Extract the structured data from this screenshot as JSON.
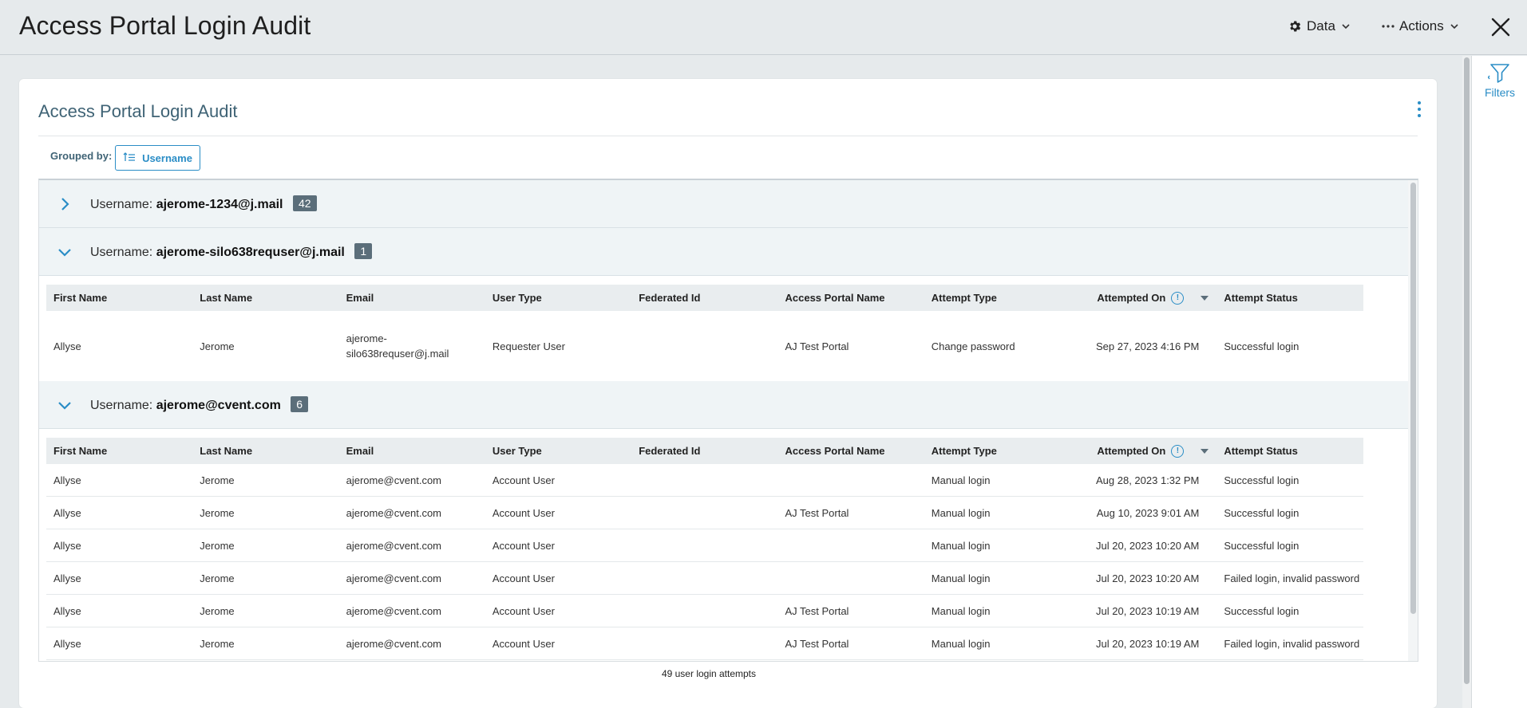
{
  "header": {
    "title": "Access Portal Login Audit",
    "data_label": "Data",
    "actions_label": "Actions"
  },
  "rail": {
    "filters_label": "Filters"
  },
  "card": {
    "title": "Access Portal Login Audit",
    "grouped_by_label": "Grouped by:",
    "group_chip_label": "Username"
  },
  "columns": [
    "First Name",
    "Last Name",
    "Email",
    "User Type",
    "Federated Id",
    "Access Portal Name",
    "Attempt Type",
    "Attempted On",
    "Attempt Status"
  ],
  "groups": [
    {
      "prefix": "Username:",
      "username": "ajerome-1234@j.mail",
      "count": "42",
      "expanded": false
    },
    {
      "prefix": "Username:",
      "username": "ajerome-silo638requser@j.mail",
      "count": "1",
      "expanded": true,
      "rows": [
        [
          "Allyse",
          "Jerome",
          "ajerome-silo638requser@j.mail",
          "Requester User",
          "",
          "AJ Test Portal",
          "Change password",
          "Sep 27, 2023 4:16 PM",
          "Successful login"
        ]
      ]
    },
    {
      "prefix": "Username:",
      "username": "ajerome@cvent.com",
      "count": "6",
      "expanded": true,
      "rows": [
        [
          "Allyse",
          "Jerome",
          "ajerome@cvent.com",
          "Account User",
          "",
          "",
          "Manual login",
          "Aug 28, 2023 1:32 PM",
          "Successful login"
        ],
        [
          "Allyse",
          "Jerome",
          "ajerome@cvent.com",
          "Account User",
          "",
          "AJ Test Portal",
          "Manual login",
          "Aug 10, 2023 9:01 AM",
          "Successful login"
        ],
        [
          "Allyse",
          "Jerome",
          "ajerome@cvent.com",
          "Account User",
          "",
          "",
          "Manual login",
          "Jul 20, 2023 10:20 AM",
          "Successful login"
        ],
        [
          "Allyse",
          "Jerome",
          "ajerome@cvent.com",
          "Account User",
          "",
          "",
          "Manual login",
          "Jul 20, 2023 10:20 AM",
          "Failed login, invalid password"
        ],
        [
          "Allyse",
          "Jerome",
          "ajerome@cvent.com",
          "Account User",
          "",
          "AJ Test Portal",
          "Manual login",
          "Jul 20, 2023 10:19 AM",
          "Successful login"
        ],
        [
          "Allyse",
          "Jerome",
          "ajerome@cvent.com",
          "Account User",
          "",
          "AJ Test Portal",
          "Manual login",
          "Jul 20, 2023 10:19 AM",
          "Failed login, invalid password"
        ]
      ]
    }
  ],
  "footer": {
    "count_text": "49 user login attempts"
  },
  "colors": {
    "accent": "#2a8dc6",
    "badge": "#5b6e7a",
    "title_slate": "#3f6375"
  }
}
